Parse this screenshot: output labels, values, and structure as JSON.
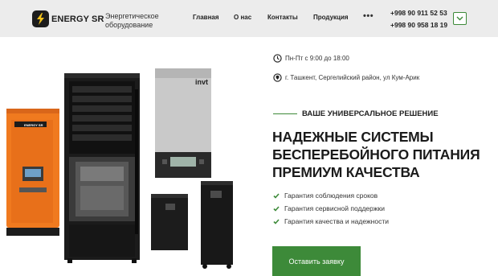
{
  "brand": {
    "name": "ENERGY SR",
    "tagline": "Энергетическое оборудование"
  },
  "nav": {
    "items": [
      "Главная",
      "О нас",
      "Контакты",
      "Продукция"
    ],
    "more": "•••"
  },
  "contacts": {
    "phones": [
      "+998 90 911 52 53",
      "+998 90 958 18 19"
    ]
  },
  "info": {
    "hours": "Пн-Пт с 9:00 до 18:00",
    "address": "г. Ташкент, Сергелийский район, ул Кум-Арик"
  },
  "hero": {
    "eyebrow": "ВАШЕ УНИВЕРСАЛЬНОЕ РЕШЕНИЕ",
    "headline": [
      "НАДЕЖНЫЕ СИСТЕМЫ",
      "БЕСПЕРЕБОЙНОГО ПИТАНИЯ",
      "ПРЕМИУМ КАЧЕСТВА"
    ],
    "benefits": [
      "Гарантия соблюдения сроков",
      "Гарантия сервисной поддержки",
      "Гарантия качества и надежности"
    ],
    "cta_label": "Оставить заявку"
  },
  "products": {
    "inverter_brand": "invt",
    "orange_unit_label": "ENERGY SR"
  },
  "colors": {
    "accent": "#3d8a39",
    "header_bg": "#ececec",
    "orange": "#f07a1f",
    "dark": "#1c1c1c"
  },
  "icons": {
    "logo": "lightning-bolt-icon",
    "menu": "chevron-down-icon",
    "hours": "clock-icon",
    "address": "map-pin-icon",
    "benefit": "check-icon"
  }
}
